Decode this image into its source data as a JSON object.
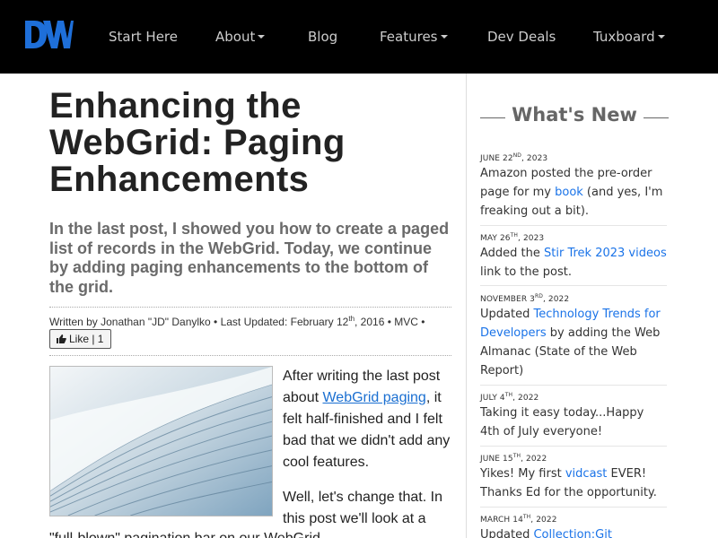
{
  "nav": {
    "logo_text": "DW",
    "items": [
      {
        "label": "Start Here",
        "dropdown": false
      },
      {
        "label": "About",
        "dropdown": true
      },
      {
        "label": "Blog",
        "dropdown": false
      },
      {
        "label": "Features",
        "dropdown": true
      },
      {
        "label": "Dev Deals",
        "dropdown": false
      },
      {
        "label": "Tuxboard",
        "dropdown": true
      }
    ]
  },
  "article": {
    "title": "Enhancing the WebGrid: Paging Enhancements",
    "subtitle": "In the last post, I showed you how to create a paged list of records in the WebGrid. Today, we continue by adding paging enhancements to the bottom of the grid.",
    "meta": {
      "written_by": "Written by Jonathan \"JD\" Danylko",
      "sep1": " • Last Updated: ",
      "updated_date": "February 12",
      "updated_sup": "th",
      "updated_year": ", 2016",
      "sep2": " • MVC •"
    },
    "like_label": "Like | 1",
    "para1_before": "After writing the last post about ",
    "para1_link": "WebGrid paging",
    "para1_after": ", it felt half-finished and I felt bad that we didn't add any cool features.",
    "para2": "Well, let's change that. In this post we'll look at a",
    "para3": "\"full-blown\" pagination bar on our WebGrid."
  },
  "sidebar": {
    "title": "What's New",
    "news": [
      {
        "date": "JUNE 22",
        "sup": "ND",
        "year": ", 2023",
        "before": "Amazon posted the pre-order page for my ",
        "link": "book",
        "after": " (and yes, I'm freaking out a bit)."
      },
      {
        "date": "MAY 26",
        "sup": "TH",
        "year": ", 2023",
        "before": "Added the ",
        "link": "Stir Trek 2023 videos",
        "after": " link to the post."
      },
      {
        "date": "NOVEMBER 3",
        "sup": "RD",
        "year": ", 2022",
        "before": "Updated ",
        "link": "Technology Trends for Developers",
        "after": " by adding the Web Almanac (State of the Web Report)"
      },
      {
        "date": "JULY 4",
        "sup": "TH",
        "year": ", 2022",
        "before": "Taking it easy today...Happy 4th of July everyone!",
        "link": "",
        "after": ""
      },
      {
        "date": "JUNE 15",
        "sup": "TH",
        "year": ", 2022",
        "before": "Yikes! My first ",
        "link": "vidcast",
        "after": " EVER! Thanks Ed for the opportunity."
      },
      {
        "date": "MARCH 14",
        "sup": "TH",
        "year": ", 2022",
        "before": "Updated ",
        "link": "Collection:Git Resources",
        "after": ""
      }
    ]
  },
  "colors": {
    "navbar_bg": "#000000",
    "logo_blue": "#1e6fd9",
    "link_blue": "#1a73e8",
    "subtitle_gray": "#6a6a6a"
  }
}
